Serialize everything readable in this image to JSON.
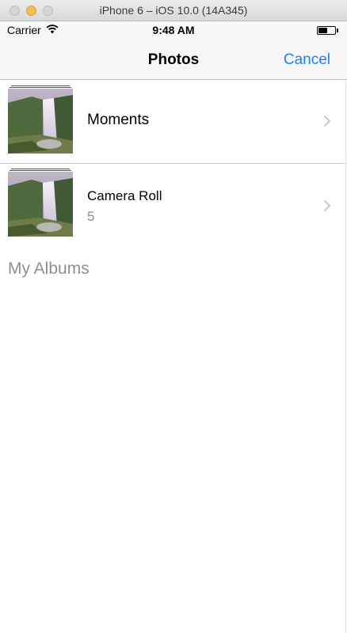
{
  "window": {
    "title": "iPhone 6 – iOS 10.0 (14A345)"
  },
  "status_bar": {
    "carrier": "Carrier",
    "time": "9:48 AM",
    "battery_level": 0.55
  },
  "nav": {
    "title": "Photos",
    "cancel_label": "Cancel"
  },
  "albums": [
    {
      "label": "Moments",
      "count": ""
    },
    {
      "label": "Camera Roll",
      "count": "5"
    }
  ],
  "section": {
    "my_albums": "My Albums"
  },
  "colors": {
    "tint": "#1a82fb",
    "secondary_text": "#8e8e93",
    "separator": "#c8c7cc",
    "bar_background": "#f7f7f7"
  },
  "icons": [
    "wifi-icon",
    "battery-icon",
    "chevron-right-icon",
    "waterfall-thumbnail"
  ]
}
